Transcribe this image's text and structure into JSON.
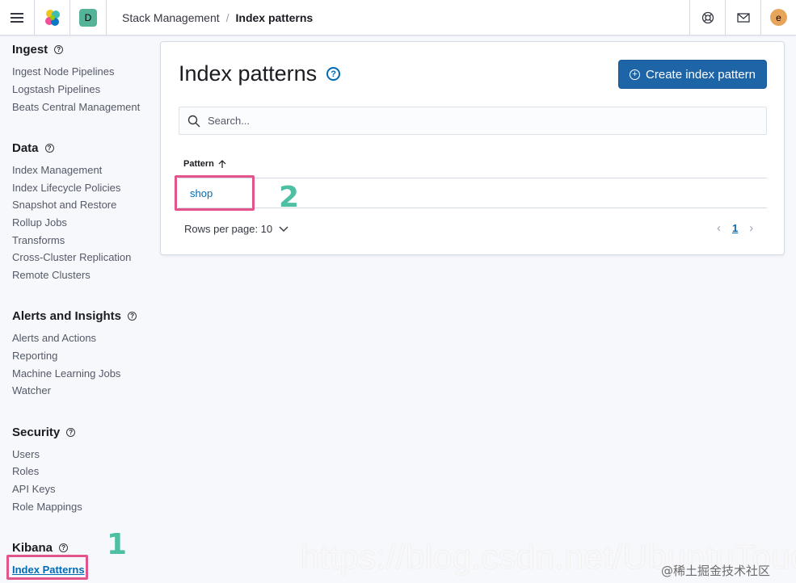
{
  "header": {
    "space_badge": "D",
    "breadcrumbs": [
      "Stack Management",
      "Index patterns"
    ],
    "avatar_initial": "e",
    "icons": [
      "menu-icon",
      "elastic-logo-icon",
      "help-icon",
      "mail-icon"
    ]
  },
  "sidebar": {
    "ingest": {
      "title": "Ingest",
      "items": [
        "Ingest Node Pipelines",
        "Logstash Pipelines",
        "Beats Central Management"
      ]
    },
    "data": {
      "title": "Data",
      "items": [
        "Index Management",
        "Index Lifecycle Policies",
        "Snapshot and Restore",
        "Rollup Jobs",
        "Transforms",
        "Cross-Cluster Replication",
        "Remote Clusters"
      ]
    },
    "alerts": {
      "title": "Alerts and Insights",
      "items": [
        "Alerts and Actions",
        "Reporting",
        "Machine Learning Jobs",
        "Watcher"
      ]
    },
    "security": {
      "title": "Security",
      "items": [
        "Users",
        "Roles",
        "API Keys",
        "Role Mappings"
      ]
    },
    "kibana": {
      "title": "Kibana",
      "items": [
        "Index Patterns"
      ]
    }
  },
  "main": {
    "title": "Index patterns",
    "create_button": "Create index pattern",
    "search_placeholder": "Search...",
    "column_header": "Pattern",
    "rows": [
      "shop"
    ],
    "rows_per_page": "Rows per page: 10",
    "current_page": "1"
  },
  "annotations": {
    "step1": "1",
    "step2": "2"
  },
  "watermark": {
    "url": "https://blog.csdn.net/UbuntuTouch",
    "site": "@稀土掘金技术社区"
  },
  "colors": {
    "accent": "#006bb4",
    "primary_button": "#1e65a8",
    "annotation_box": "#e2548b",
    "annotation_number": "#4fbfa3",
    "space_badge": "#54b399",
    "avatar": "#e7a55c"
  }
}
